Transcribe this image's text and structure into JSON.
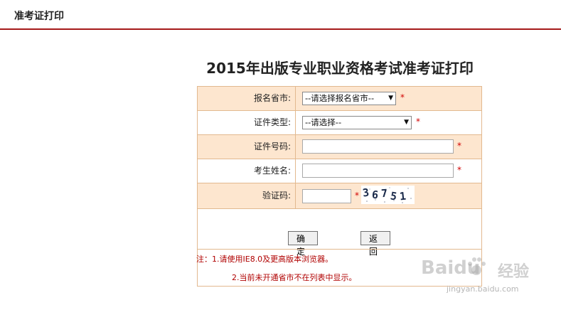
{
  "header": {
    "title": "准考证打印"
  },
  "page": {
    "heading": "2015年出版专业职业资格考试准考证打印"
  },
  "form": {
    "province": {
      "label": "报名省市:",
      "selected": "--请选择报名省市--",
      "required_mark": "*"
    },
    "id_type": {
      "label": "证件类型:",
      "selected": "--请选择--",
      "required_mark": "*"
    },
    "id_number": {
      "label": "证件号码:",
      "value": "",
      "required_mark": "*"
    },
    "name": {
      "label": "考生姓名:",
      "value": "",
      "required_mark": "*"
    },
    "captcha": {
      "label": "验证码:",
      "value": "",
      "required_mark": "*",
      "image_text": [
        "3",
        "6",
        "7",
        "5",
        "1"
      ]
    }
  },
  "buttons": {
    "confirm": "确定",
    "back": "返回"
  },
  "notes": {
    "line1": "注：1.请使用IE8.0及更高版本浏览器。",
    "line2": "2.当前未开通省市不在列表中显示。"
  },
  "watermark": {
    "brand": "Baidu",
    "cn": "经验",
    "url": "jingyan.baidu.com"
  },
  "colors": {
    "accent_line": "#a51a1a",
    "row_tint": "#fde6cf",
    "border": "#e2b98f",
    "required": "#d10000",
    "note_text": "#b00000"
  }
}
